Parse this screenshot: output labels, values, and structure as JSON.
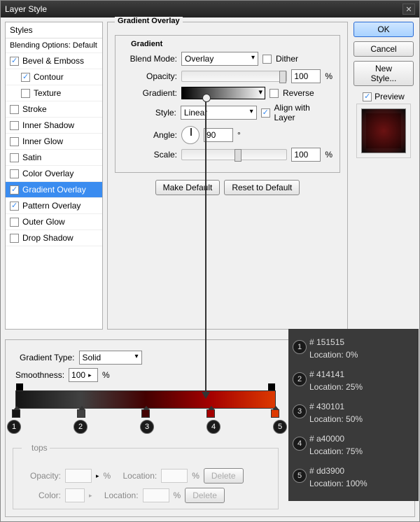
{
  "window": {
    "title": "Layer Style"
  },
  "styles": {
    "hdr": "Styles",
    "sub": "Blending Options: Default",
    "items": [
      {
        "label": "Bevel & Emboss",
        "checked": true,
        "indent": false
      },
      {
        "label": "Contour",
        "checked": true,
        "indent": true
      },
      {
        "label": "Texture",
        "checked": false,
        "indent": true
      },
      {
        "label": "Stroke",
        "checked": false,
        "indent": false
      },
      {
        "label": "Inner Shadow",
        "checked": false,
        "indent": false
      },
      {
        "label": "Inner Glow",
        "checked": false,
        "indent": false
      },
      {
        "label": "Satin",
        "checked": false,
        "indent": false
      },
      {
        "label": "Color Overlay",
        "checked": false,
        "indent": false
      },
      {
        "label": "Gradient Overlay",
        "checked": true,
        "indent": false,
        "selected": true
      },
      {
        "label": "Pattern Overlay",
        "checked": true,
        "indent": false
      },
      {
        "label": "Outer Glow",
        "checked": false,
        "indent": false
      },
      {
        "label": "Drop Shadow",
        "checked": false,
        "indent": false
      }
    ]
  },
  "overlay": {
    "title": "Gradient Overlay",
    "group": "Gradient",
    "blend_label": "Blend Mode:",
    "blend_value": "Overlay",
    "dither": "Dither",
    "opacity_label": "Opacity:",
    "opacity_value": "100",
    "pct": "%",
    "gradient_label": "Gradient:",
    "reverse": "Reverse",
    "style_label": "Style:",
    "style_value": "Linear",
    "align": "Align with Layer",
    "angle_label": "Angle:",
    "angle_value": "90",
    "deg": "°",
    "scale_label": "Scale:",
    "scale_value": "100",
    "make_default": "Make Default",
    "reset_default": "Reset to Default"
  },
  "right": {
    "ok": "OK",
    "cancel": "Cancel",
    "new_style": "New Style...",
    "preview": "Preview"
  },
  "editor": {
    "type_label": "Gradient Type:",
    "type_value": "Solid",
    "smooth_label": "Smoothness:",
    "smooth_value": "100",
    "pct": "%",
    "stops_label": "Stops",
    "opacity_label": "Opacity:",
    "location_label": "Location:",
    "color_label": "Color:",
    "delete": "Delete"
  },
  "stops": [
    {
      "n": "1",
      "hex": "# 151515",
      "loc": "Location: 0%",
      "pos": 0,
      "color": "#151515"
    },
    {
      "n": "2",
      "hex": "# 414141",
      "loc": "Location: 25%",
      "pos": 25,
      "color": "#414141"
    },
    {
      "n": "3",
      "hex": "# 430101",
      "loc": "Location: 50%",
      "pos": 50,
      "color": "#430101"
    },
    {
      "n": "4",
      "hex": "# a40000",
      "loc": "Location: 75%",
      "pos": 75,
      "color": "#a40000"
    },
    {
      "n": "5",
      "hex": "# dd3900",
      "loc": "Location: 100%",
      "pos": 100,
      "color": "#dd3900"
    }
  ]
}
